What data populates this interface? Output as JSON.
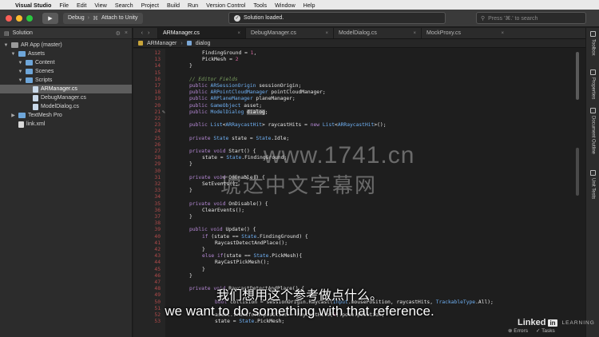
{
  "menubar": {
    "app": "Visual Studio",
    "items": [
      "File",
      "Edit",
      "View",
      "Search",
      "Project",
      "Build",
      "Run",
      "Version Control",
      "Tools",
      "Window",
      "Help"
    ]
  },
  "toolbar": {
    "config": "Debug",
    "target": "Attach to Unity",
    "status": "Solution loaded.",
    "search_placeholder": "Press '⌘.' to search"
  },
  "solution": {
    "pad_title": "Solution",
    "items": [
      {
        "label": "AR App (master)",
        "depth": 0,
        "kind": "solution"
      },
      {
        "label": "Assets",
        "depth": 1,
        "kind": "folder"
      },
      {
        "label": "Content",
        "depth": 2,
        "kind": "folder"
      },
      {
        "label": "Scenes",
        "depth": 2,
        "kind": "folder"
      },
      {
        "label": "Scripts",
        "depth": 2,
        "kind": "folder"
      },
      {
        "label": "ARManager.cs",
        "depth": 3,
        "kind": "cs",
        "selected": true
      },
      {
        "label": "DebugManager.cs",
        "depth": 3,
        "kind": "cs"
      },
      {
        "label": "ModelDialog.cs",
        "depth": 3,
        "kind": "cs"
      },
      {
        "label": "TextMesh Pro",
        "depth": 1,
        "kind": "folder"
      },
      {
        "label": "link.xml",
        "depth": 1,
        "kind": "file"
      }
    ]
  },
  "tabs": [
    {
      "label": "ARManager.cs",
      "active": true
    },
    {
      "label": "DebugManager.cs",
      "active": false
    },
    {
      "label": "ModelDialog.cs",
      "active": false
    },
    {
      "label": "MockProxy.cs",
      "active": false
    }
  ],
  "pathbar": {
    "class_name": "ARManager",
    "member": "dialog"
  },
  "code_lines": [
    {
      "n": "12",
      "indent": 4,
      "parts": [
        [
          "n",
          "FindingGround = "
        ],
        [
          "nm",
          "1"
        ],
        [
          "n",
          ","
        ]
      ]
    },
    {
      "n": "13",
      "indent": 4,
      "parts": [
        [
          "n",
          "PickMesh = "
        ],
        [
          "nm",
          "2"
        ]
      ]
    },
    {
      "n": "14",
      "indent": 0,
      "parts": [
        [
          "n",
          "}"
        ]
      ]
    },
    {
      "n": "15",
      "indent": 0,
      "parts": []
    },
    {
      "n": "16",
      "indent": 0,
      "parts": [
        [
          "cm",
          "// Editor Fields"
        ]
      ]
    },
    {
      "n": "17",
      "indent": 0,
      "parts": [
        [
          "k",
          "public "
        ],
        [
          "t",
          "ARSessionOrigin"
        ],
        [
          "n",
          " sessionOrigin;"
        ]
      ]
    },
    {
      "n": "18",
      "indent": 0,
      "parts": [
        [
          "k",
          "public "
        ],
        [
          "t",
          "ARPointCloudManager"
        ],
        [
          "n",
          " pointCloudManager;"
        ]
      ]
    },
    {
      "n": "19",
      "indent": 0,
      "parts": [
        [
          "k",
          "public "
        ],
        [
          "t",
          "ARPlaneManager"
        ],
        [
          "n",
          " planeManager;"
        ]
      ]
    },
    {
      "n": "20",
      "indent": 0,
      "parts": [
        [
          "k",
          "public "
        ],
        [
          "t",
          "GameObject"
        ],
        [
          "n",
          " asset;"
        ]
      ]
    },
    {
      "n": "21",
      "indent": 0,
      "parts": [
        [
          "k",
          "public "
        ],
        [
          "t",
          "ModelDialog"
        ],
        [
          "n",
          " "
        ],
        [
          "hl",
          "dialog"
        ],
        [
          "n",
          ";"
        ]
      ]
    },
    {
      "n": "22",
      "indent": 0,
      "parts": []
    },
    {
      "n": "23",
      "indent": 0,
      "parts": [
        [
          "k",
          "public "
        ],
        [
          "t",
          "List"
        ],
        [
          "n",
          "<"
        ],
        [
          "t",
          "ARRaycastHit"
        ],
        [
          "n",
          "> raycastHits = "
        ],
        [
          "k",
          "new "
        ],
        [
          "t",
          "List"
        ],
        [
          "n",
          "<"
        ],
        [
          "t",
          "ARRaycastHit"
        ],
        [
          "n",
          ">();"
        ]
      ]
    },
    {
      "n": "24",
      "indent": 0,
      "parts": []
    },
    {
      "n": "25",
      "indent": 0,
      "parts": [
        [
          "k",
          "private "
        ],
        [
          "t",
          "State"
        ],
        [
          "n",
          " state = "
        ],
        [
          "t",
          "State"
        ],
        [
          "n",
          ".Idle;"
        ]
      ]
    },
    {
      "n": "26",
      "indent": 0,
      "parts": []
    },
    {
      "n": "27",
      "indent": 0,
      "parts": [
        [
          "k",
          "private void "
        ],
        [
          "n",
          "Start() {"
        ]
      ]
    },
    {
      "n": "28",
      "indent": 4,
      "parts": [
        [
          "n",
          "state = "
        ],
        [
          "t",
          "State"
        ],
        [
          "n",
          ".FindingGround;"
        ]
      ]
    },
    {
      "n": "29",
      "indent": 0,
      "parts": [
        [
          "n",
          "}"
        ]
      ]
    },
    {
      "n": "30",
      "indent": 0,
      "parts": []
    },
    {
      "n": "31",
      "indent": 0,
      "parts": [
        [
          "k",
          "private void "
        ],
        [
          "n",
          "OnEnable() {"
        ]
      ]
    },
    {
      "n": "32",
      "indent": 4,
      "parts": [
        [
          "n",
          "SetEvents();"
        ]
      ]
    },
    {
      "n": "33",
      "indent": 0,
      "parts": [
        [
          "n",
          "}"
        ]
      ]
    },
    {
      "n": "34",
      "indent": 0,
      "parts": []
    },
    {
      "n": "35",
      "indent": 0,
      "parts": [
        [
          "k",
          "private void "
        ],
        [
          "n",
          "OnDisable() {"
        ]
      ]
    },
    {
      "n": "36",
      "indent": 4,
      "parts": [
        [
          "n",
          "ClearEvents();"
        ]
      ]
    },
    {
      "n": "37",
      "indent": 0,
      "parts": [
        [
          "n",
          "}"
        ]
      ]
    },
    {
      "n": "38",
      "indent": 0,
      "parts": []
    },
    {
      "n": "39",
      "indent": 0,
      "parts": [
        [
          "k",
          "public void "
        ],
        [
          "n",
          "Update() {"
        ]
      ]
    },
    {
      "n": "40",
      "indent": 4,
      "parts": [
        [
          "k",
          "if "
        ],
        [
          "n",
          "(state == "
        ],
        [
          "t",
          "State"
        ],
        [
          "n",
          ".FindingGround) {"
        ]
      ]
    },
    {
      "n": "41",
      "indent": 8,
      "parts": [
        [
          "n",
          "RaycastDetectAndPlace();"
        ]
      ]
    },
    {
      "n": "42",
      "indent": 4,
      "parts": [
        [
          "n",
          "}"
        ]
      ]
    },
    {
      "n": "43",
      "indent": 4,
      "parts": [
        [
          "k",
          "else if"
        ],
        [
          "n",
          "(state == "
        ],
        [
          "t",
          "State"
        ],
        [
          "n",
          ".PickMesh){"
        ]
      ]
    },
    {
      "n": "44",
      "indent": 8,
      "parts": [
        [
          "n",
          "RayCastPickMesh();"
        ]
      ]
    },
    {
      "n": "45",
      "indent": 4,
      "parts": [
        [
          "n",
          "}"
        ]
      ]
    },
    {
      "n": "46",
      "indent": 0,
      "parts": [
        [
          "n",
          "}"
        ]
      ]
    },
    {
      "n": "47",
      "indent": 0,
      "parts": []
    },
    {
      "n": "48",
      "indent": 0,
      "parts": [
        [
          "k",
          "private void "
        ],
        [
          "n",
          "RaycastDetectAndPlace() {"
        ]
      ]
    },
    {
      "n": "49",
      "indent": 8,
      "parts": []
    },
    {
      "n": "50",
      "indent": 8,
      "parts": [
        [
          "k",
          "bool "
        ],
        [
          "n",
          "collision = sessionOrigin.Raycast("
        ],
        [
          "t",
          "Input"
        ],
        [
          "n",
          ".mousePosition, raycastHits, "
        ],
        [
          "t",
          "TrackableType"
        ],
        [
          "n",
          ".All);"
        ]
      ]
    },
    {
      "n": "51",
      "indent": 8,
      "parts": []
    },
    {
      "n": "52",
      "indent": 8,
      "parts": [
        [
          "n",
          "asset.transform.position = raycastHits["
        ],
        [
          "nm",
          "0"
        ],
        [
          "n",
          "].pose.position;"
        ]
      ]
    },
    {
      "n": "53",
      "indent": 8,
      "parts": [
        [
          "n",
          "state = "
        ],
        [
          "t",
          "State"
        ],
        [
          "n",
          ".PickMesh;"
        ]
      ]
    }
  ],
  "right_pads": [
    "Toolbox",
    "Properties",
    "Document Outline",
    "Unit Tests"
  ],
  "watermark": {
    "line1": "www.1741.cn",
    "line2": "琥达中文字幕网"
  },
  "subtitles": {
    "cn": "我们想用这个参考做点什么。",
    "en": "we want to do something with that reference."
  },
  "branding": {
    "name": "Linked",
    "in": "in",
    "suffix": "LEARNING"
  },
  "statusbar": {
    "errors": "Errors",
    "tasks": "Tasks"
  },
  "colors": {
    "keyword": "#b689d6",
    "type": "#6fb0f3",
    "comment": "#7aa05f",
    "number": "#d86aa0",
    "line_number": "#b04a4a"
  }
}
